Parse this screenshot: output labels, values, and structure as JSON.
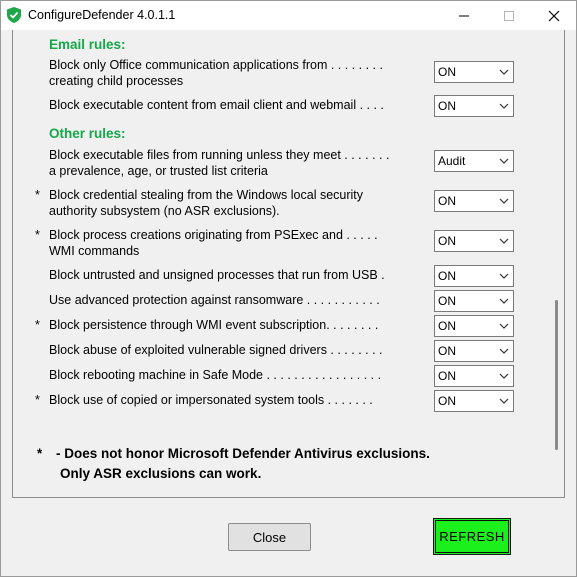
{
  "window": {
    "title": "ConfigureDefender 4.0.1.1",
    "accent": "#1cf01c",
    "section_color": "#15a84a"
  },
  "sections": {
    "email": "Email rules:",
    "other": "Other rules:"
  },
  "rules": [
    {
      "star": "",
      "lines": [
        "Block only Office communication applications from . . . . . . . .",
        "creating child processes"
      ],
      "value": "ON"
    },
    {
      "star": "",
      "lines": [
        "Block executable content from email client and webmail . . . ."
      ],
      "value": "ON"
    },
    {
      "star": "",
      "lines": [
        "Block executable files from running unless they meet . . . . . . .",
        "a prevalence, age, or trusted list criteria"
      ],
      "value": "Audit"
    },
    {
      "star": "*",
      "lines": [
        "Block credential stealing from the Windows local security",
        "authority subsystem (no ASR exclusions)."
      ],
      "value": "ON"
    },
    {
      "star": "*",
      "lines": [
        "Block process creations originating from PSExec and . . . . .",
        "WMI commands"
      ],
      "value": "ON"
    },
    {
      "star": "",
      "lines": [
        "Block untrusted and unsigned processes that run from USB ."
      ],
      "value": "ON"
    },
    {
      "star": "",
      "lines": [
        "Use advanced protection against ransomware . . . . . . . . . . ."
      ],
      "value": "ON"
    },
    {
      "star": "*",
      "lines": [
        "Block persistence through WMI event subscription. . . . . . . ."
      ],
      "value": "ON"
    },
    {
      "star": "",
      "lines": [
        "Block abuse of exploited vulnerable signed drivers . . . . . . . ."
      ],
      "value": "ON"
    },
    {
      "star": "",
      "lines": [
        "Block rebooting machine in Safe Mode . . . . . . . . . . . . . . . . ."
      ],
      "value": "ON"
    },
    {
      "star": "*",
      "lines": [
        "Block use of copied or impersonated system tools . . . . . . ."
      ],
      "value": "ON"
    }
  ],
  "footnote": {
    "star": "*",
    "line1": "- Does not honor Microsoft Defender Antivirus exclusions.",
    "line2": "Only ASR exclusions can work."
  },
  "buttons": {
    "close": "Close",
    "refresh": "REFRESH"
  }
}
